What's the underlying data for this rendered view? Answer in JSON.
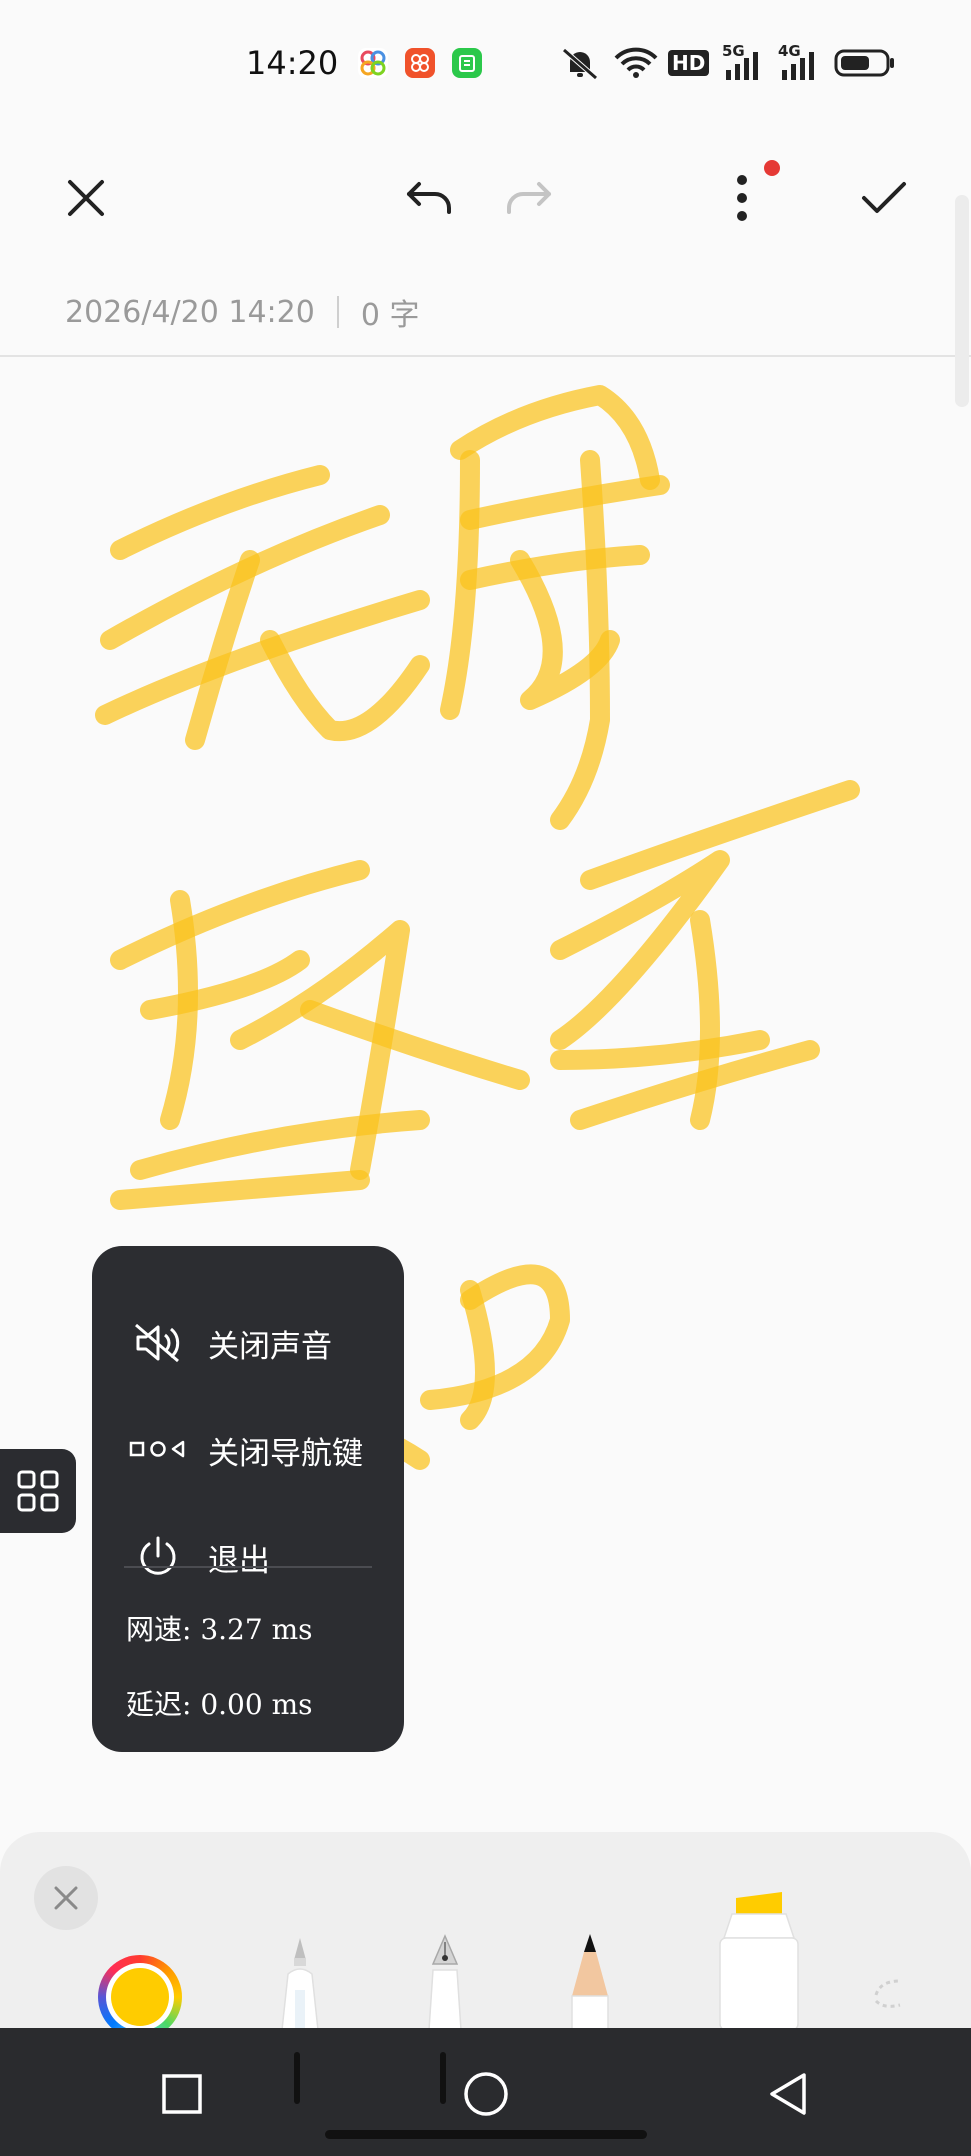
{
  "status_bar": {
    "time": "14:20",
    "hd_label": "HD",
    "net1": "5G",
    "net2": "4G",
    "icons": [
      "app-multicolor-icon",
      "app-orange-icon",
      "app-green-icon",
      "mute-bell-icon",
      "wifi-icon",
      "hd-icon",
      "signal-5g-icon",
      "signal-4g-icon",
      "battery-icon"
    ]
  },
  "header": {
    "timestamp": "2026/4/20 14:20",
    "word_count": "0 字",
    "icons": [
      "close-icon",
      "undo-icon",
      "redo-icon",
      "more-icon",
      "check-icon"
    ],
    "notification_dot_color": "#e53935"
  },
  "float_menu": {
    "items": [
      {
        "label": "关闭声音",
        "icon": "sound-off-icon"
      },
      {
        "label": "关闭导航键",
        "icon": "nav-keys-icon"
      },
      {
        "label": "退出",
        "icon": "power-icon"
      }
    ],
    "network_speed": "网速: 3.27 ms",
    "latency": "延迟: 0.00 ms"
  },
  "pen_toolbar": {
    "selected_color": "#ffcc00",
    "tools": [
      "color-picker",
      "ballpoint-pen",
      "fountain-pen",
      "pencil",
      "highlighter",
      "eraser"
    ]
  },
  "nav_bar": {
    "icons": [
      "recents-square-icon",
      "home-circle-icon",
      "back-triangle-icon"
    ]
  },
  "colors": {
    "ink": "#f9c21c",
    "menu_bg": "#2c2d31",
    "nav_bg": "#2a2b2e"
  }
}
